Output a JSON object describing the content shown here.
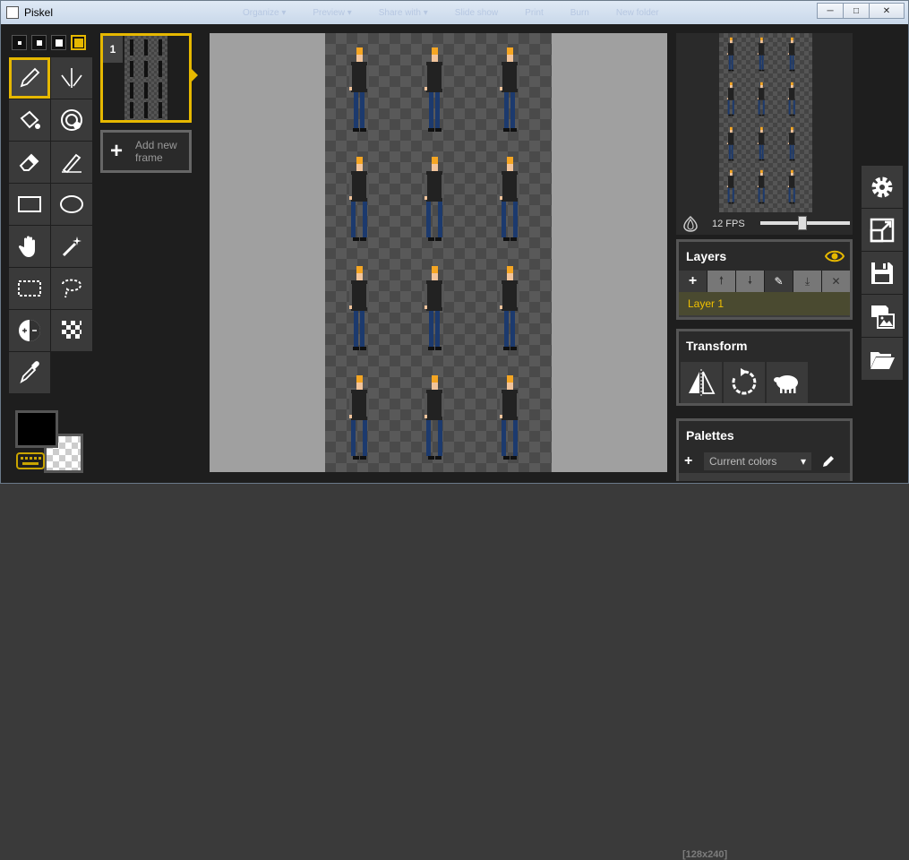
{
  "window": {
    "title": "Piskel",
    "buttons": {
      "minimize": "─",
      "maximize": "□",
      "close": "✕"
    }
  },
  "background_taskbar_ghost": [
    "Organize ▾",
    "Preview ▾",
    "Share with ▾",
    "Slide show",
    "Print",
    "Burn",
    "New folder"
  ],
  "tools": {
    "pen_sizes": [
      1,
      2,
      3,
      4
    ],
    "selected_pen_size": 4,
    "list": [
      "pen-icon",
      "vertical-mirror-pen-icon",
      "paint-bucket-icon",
      "paint-same-color-icon",
      "eraser-icon",
      "stroke-icon",
      "rectangle-icon",
      "circle-icon",
      "move-hand-icon",
      "magic-wand-icon",
      "rectangle-select-icon",
      "lasso-select-icon",
      "lighten-icon",
      "dithering-icon",
      "color-picker-icon"
    ],
    "selected": "pen-icon",
    "primary_color": "#000000",
    "secondary_color": "transparent"
  },
  "frames": {
    "items": [
      {
        "number": "1"
      }
    ],
    "add_frame_label": "Add new frame"
  },
  "preview": {
    "fps_label": "12 FPS",
    "fps": 12
  },
  "layers": {
    "title": "Layers",
    "items": [
      {
        "name": "Layer 1"
      }
    ]
  },
  "transform": {
    "title": "Transform"
  },
  "palettes": {
    "title": "Palettes",
    "selected": "Current colors",
    "arrow": "▾"
  },
  "canvas": {
    "size_readout": "[128x240]"
  },
  "colors": {
    "accent": "#e6b800",
    "panel": "#3c3c3c",
    "background": "#1e1e1e",
    "frame_background": "#a0a0a0"
  }
}
